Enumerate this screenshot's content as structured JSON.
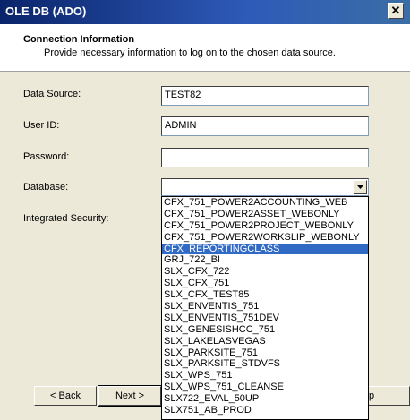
{
  "window": {
    "title": "OLE DB (ADO)",
    "close_glyph": "✕"
  },
  "header": {
    "title": "Connection Information",
    "subtitle": "Provide necessary information to log on to the chosen data source."
  },
  "form": {
    "data_source_label": "Data Source:",
    "data_source_value": "TEST82",
    "user_id_label": "User ID:",
    "user_id_value": "ADMIN",
    "password_label": "Password:",
    "password_value": "",
    "database_label": "Database:",
    "database_value": "",
    "integrated_security_label": "Integrated Security:"
  },
  "database_list": {
    "selected_index": 4,
    "items": [
      "CFX_751_POWER2ACCOUNTING_WEB",
      "CFX_751_POWER2ASSET_WEBONLY",
      "CFX_751_POWER2PROJECT_WEBONLY",
      "CFX_751_POWER2WORKSLIP_WEBONLY",
      "CFX_REPORTINGCLASS",
      "GRJ_722_BI",
      "SLX_CFX_722",
      "SLX_CFX_751",
      "SLX_CFX_TEST85",
      "SLX_ENVENTIS_751",
      "SLX_ENVENTIS_751DEV",
      "SLX_GENESISHCC_751",
      "SLX_LAKELASVEGAS",
      "SLX_PARKSITE_751",
      "SLX_PARKSITE_STDVFS",
      "SLX_WPS_751",
      "SLX_WPS_751_CLEANSE",
      "SLX722_EVAL_50UP",
      "SLX751_AB_PROD"
    ]
  },
  "buttons": {
    "back": "< Back",
    "next": "Next >",
    "partial": "p"
  },
  "colors": {
    "selection": "#316ac5",
    "titlebar": "#0a246a"
  }
}
